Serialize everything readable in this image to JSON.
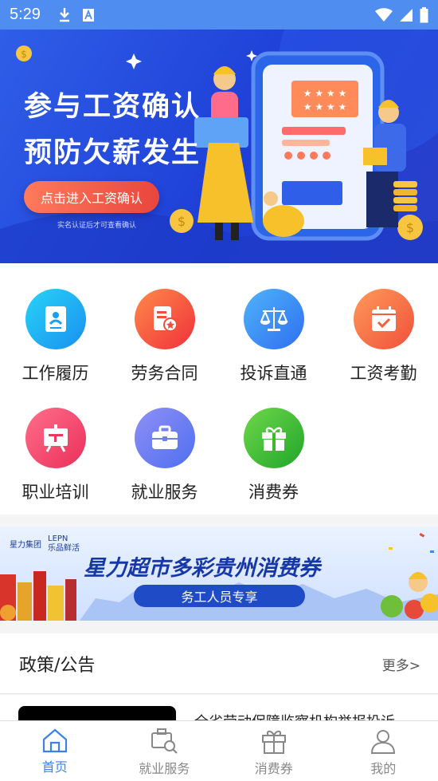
{
  "status_bar": {
    "time": "5:29",
    "icons": [
      "download-icon",
      "font-a-icon",
      "wifi-icon",
      "signal-icon",
      "battery-icon"
    ]
  },
  "banner": {
    "line1": "参与工资确认",
    "line2": "预防欠薪发生",
    "button": "点击进入工资确认",
    "note": "实名认证后才可查看确认"
  },
  "grid": {
    "items": [
      {
        "label": "工作履历",
        "icon": "resume-icon",
        "color": "#1fb6f0"
      },
      {
        "label": "劳务合同",
        "icon": "contract-icon",
        "color": "#f4513b"
      },
      {
        "label": "投诉直通",
        "icon": "scale-icon",
        "color": "#3d8bf0"
      },
      {
        "label": "工资考勤",
        "icon": "calendar-icon",
        "color": "#f5603e"
      },
      {
        "label": "职业培训",
        "icon": "board-icon",
        "color": "#ee3f6a"
      },
      {
        "label": "就业服务",
        "icon": "briefcase-icon",
        "color": "#6f7ff0"
      },
      {
        "label": "消费券",
        "icon": "gift-icon",
        "color": "#3dba2b"
      }
    ]
  },
  "promo": {
    "brand1": "星力集团",
    "brand2": "LEPN",
    "brand3": "乐品鲜活",
    "title": "星力超市多彩贵州消费券",
    "tag": "务工人员专享"
  },
  "policy": {
    "heading": "政策/公告",
    "more": "更多>",
    "first_item": "全省劳动保障监察机构举报投诉"
  },
  "bottom_nav": {
    "items": [
      {
        "label": "首页",
        "active": true
      },
      {
        "label": "就业服务",
        "active": false
      },
      {
        "label": "消费券",
        "active": false
      },
      {
        "label": "我的",
        "active": false
      }
    ]
  },
  "colors": {
    "status_bar": "#4f8ef0",
    "banner_bg": "#2450de",
    "active_nav": "#3b82e8"
  }
}
